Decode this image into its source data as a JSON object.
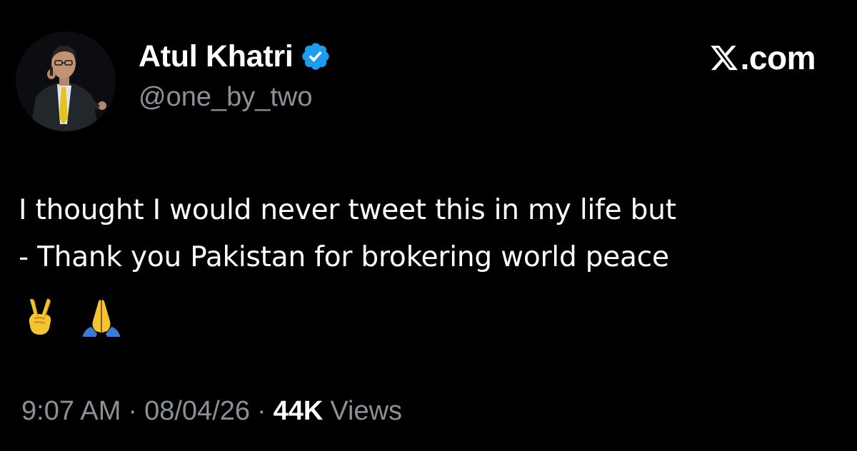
{
  "brand": {
    "site_label": ".com"
  },
  "author": {
    "display_name": "Atul Khatri",
    "handle": "@one_by_two",
    "verified": true
  },
  "tweet": {
    "lines": [
      "I thought I would never tweet this in my life but",
      "- Thank you Pakistan for brokering world peace"
    ],
    "emojis": [
      "✌️",
      "🙏"
    ]
  },
  "meta": {
    "time": "9:07 AM",
    "separator": "·",
    "date": "08/04/26",
    "views_count": "44K",
    "views_label": "Views"
  },
  "colors": {
    "background": "#000000",
    "primary_text": "#ffffff",
    "secondary_text": "#8b9197",
    "verified_blue": "#1d9bf0"
  },
  "icons": {
    "verified": "verified-badge-icon",
    "x_logo": "x-logo-icon",
    "emoji_1": "victory-hand-icon",
    "emoji_2": "folded-hands-icon"
  }
}
